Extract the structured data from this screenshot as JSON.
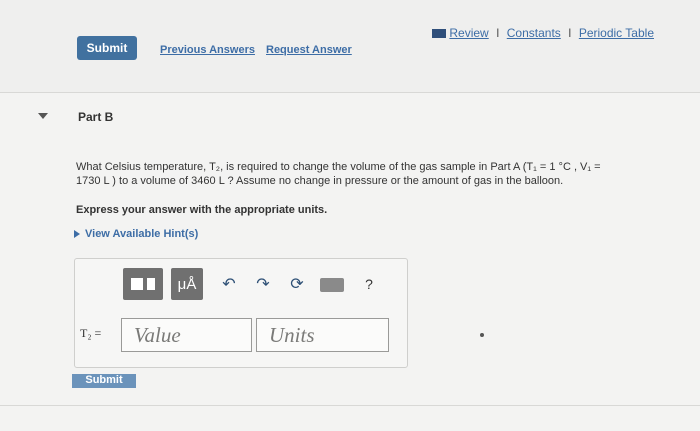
{
  "header": {
    "review_label": "Review",
    "constants_label": "Constants",
    "periodic_label": "Periodic Table",
    "sep": "I"
  },
  "part_a_controls": {
    "submit_label": "Submit",
    "previous_answers_label": "Previous Answers",
    "request_answer_label": "Request Answer"
  },
  "part_b": {
    "title": "Part B",
    "question_line1": "What Celsius temperature, T₂, is required to change the volume of the gas sample in Part A (T₁ = 1 °C , V₁ =",
    "question_line2": "1730 L ) to a volume of 3460 L ? Assume no change in pressure or the amount of gas in the balloon.",
    "express": "Express your answer with the appropriate units.",
    "hint_label": "View Available Hint(s)",
    "answer_label": "T₂ =",
    "value_placeholder": "Value",
    "units_placeholder": "Units",
    "submit_label": "Submit",
    "toolbar": {
      "template_icon": "templates-icon",
      "symbols_icon": "symbols-icon",
      "undo_icon": "undo-icon",
      "redo_icon": "redo-icon",
      "reset_icon": "reset-icon",
      "keyboard_icon": "keyboard-icon",
      "help_label": "?"
    }
  },
  "colors": {
    "link": "#3d6da6",
    "button": "#41719f",
    "toolbar_gray": "#707070"
  }
}
